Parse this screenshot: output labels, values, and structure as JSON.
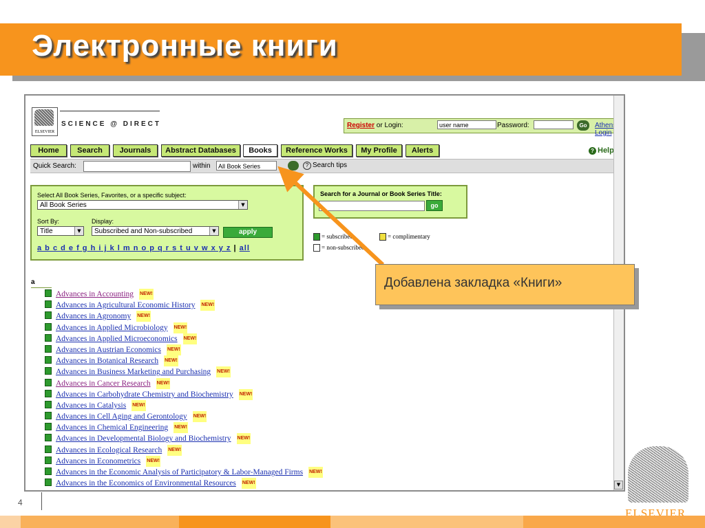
{
  "slide": {
    "title": "Электронные книги",
    "page_number": "4",
    "callout": "Добавлена закладка «Книги»",
    "publisher_logo_text": "ELSEVIER"
  },
  "sd": {
    "logo_caption": "ELSEVIER",
    "brand": "SCIENCE @ DIRECT",
    "login": {
      "register": "Register",
      "or_login": "or Login:",
      "username_value": "user name",
      "password_label": "Password:",
      "go": "Go",
      "athens": "Athens Login"
    },
    "tabs": [
      "Home",
      "Search",
      "Journals",
      "Abstract Databases",
      "Books",
      "Reference Works",
      "My Profile",
      "Alerts"
    ],
    "help": "Help",
    "quick": {
      "label": "Quick Search:",
      "within": "within",
      "scope": "All Book Series",
      "tips": "Search tips"
    },
    "browse": {
      "prompt": "Select All Book Series, Favorites, or a specific subject:",
      "subject": "All Book Series",
      "sort_label": "Sort By:",
      "sort_value": "Title",
      "display_label": "Display:",
      "display_value": "Subscribed and Non-subscribed",
      "apply": "apply",
      "letters": "a b c d e f g h i j k l m n o p q r s t u v w x y z",
      "all": "all"
    },
    "journal_search": {
      "label": "Search for a Journal or Book Series Title:",
      "go": "go"
    },
    "legend": {
      "subscribed": "= subscribed",
      "complimentary": "= complimentary",
      "non_subscribed": "= non-subscribed",
      "colors": {
        "subscribed": "#2e9a2e",
        "complimentary": "#f0e040",
        "non_subscribed": "#ffffff"
      }
    },
    "letter_heading": "a",
    "new_badge": "NEW!",
    "books": [
      "Advances in Accounting",
      "Advances in Agricultural Economic History",
      "Advances in Agronomy",
      "Advances in Applied Microbiology",
      "Advances in Applied Microeconomics",
      "Advances in Austrian Economics",
      "Advances in Botanical Research",
      "Advances in Business Marketing and Purchasing",
      "Advances in Cancer Research",
      "Advances in Carbohydrate Chemistry and Biochemistry",
      "Advances in Catalysis",
      "Advances in Cell Aging and Gerontology",
      "Advances in Chemical Engineering",
      "Advances in Developmental Biology and Biochemistry",
      "Advances in Ecological Research",
      "Advances in Econometrics",
      "Advances in the Economic Analysis of Participatory & Labor-Managed Firms",
      "Advances in the Economics of Environmental Resources"
    ]
  },
  "colors": {
    "orange": "#f7941d",
    "callout": "#fec45a",
    "sd_green": "#d8f9a0"
  }
}
